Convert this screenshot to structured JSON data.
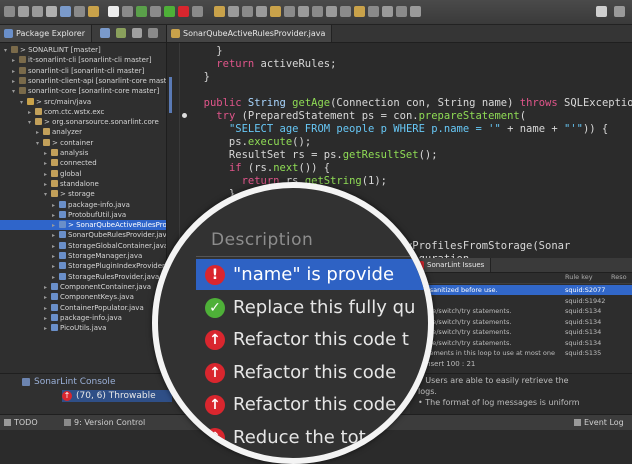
{
  "colors": {
    "accent": "#2f65ca",
    "error": "#d9262e",
    "ok": "#4eb038",
    "keyword": "#e0558a",
    "string": "#67c7f5"
  },
  "explorer": {
    "tabs": [
      {
        "label": "Package Explorer",
        "icon": "package-icon"
      }
    ],
    "items": [
      {
        "label": "> SONARLINT [master]",
        "depth": 0,
        "kind": "project",
        "expanded": true
      },
      {
        "label": "it-sonarlint-cli [sonarlint-cli master]",
        "depth": 1,
        "kind": "project"
      },
      {
        "label": "sonarlint-cli [sonarlint-cli master]",
        "depth": 1,
        "kind": "project"
      },
      {
        "label": "sonarlint-client-api [sonarlint-core master]",
        "depth": 1,
        "kind": "project"
      },
      {
        "label": "sonarlint-core [sonarlint-core master]",
        "depth": 1,
        "kind": "project",
        "expanded": true
      },
      {
        "label": "> src/main/java",
        "depth": 2,
        "kind": "folder",
        "expanded": true
      },
      {
        "label": "com.ctc.wstx.exc",
        "depth": 3,
        "kind": "package"
      },
      {
        "label": "> org.sonarsource.sonarlint.core",
        "depth": 3,
        "kind": "package",
        "expanded": true
      },
      {
        "label": "analyzer",
        "depth": 4,
        "kind": "package"
      },
      {
        "label": "> container",
        "depth": 4,
        "kind": "package",
        "expanded": true
      },
      {
        "label": "analysis",
        "depth": 5,
        "kind": "package"
      },
      {
        "label": "connected",
        "depth": 5,
        "kind": "package"
      },
      {
        "label": "global",
        "depth": 5,
        "kind": "package"
      },
      {
        "label": "standalone",
        "depth": 5,
        "kind": "package"
      },
      {
        "label": "> storage",
        "depth": 5,
        "kind": "package",
        "expanded": true
      },
      {
        "label": "package-info.java",
        "depth": 6,
        "kind": "java"
      },
      {
        "label": "ProtobufUtil.java",
        "depth": 6,
        "kind": "java"
      },
      {
        "label": "> SonarQubeActiveRulesProvider.java",
        "depth": 6,
        "kind": "java",
        "selected": true
      },
      {
        "label": "SonarQubeRulesProvider.java",
        "depth": 6,
        "kind": "java"
      },
      {
        "label": "StorageGlobalContainer.java",
        "depth": 6,
        "kind": "java"
      },
      {
        "label": "StorageManager.java",
        "depth": 6,
        "kind": "java"
      },
      {
        "label": "StoragePluginIndexProvider.java",
        "depth": 6,
        "kind": "java"
      },
      {
        "label": "StorageRulesProvider.java",
        "depth": 6,
        "kind": "java"
      },
      {
        "label": "ComponentContainer.java",
        "depth": 5,
        "kind": "java"
      },
      {
        "label": "ComponentKeys.java",
        "depth": 5,
        "kind": "java"
      },
      {
        "label": "ContainerPopulator.java",
        "depth": 5,
        "kind": "java"
      },
      {
        "label": "package-info.java",
        "depth": 5,
        "kind": "java"
      },
      {
        "label": "PicoUtils.java",
        "depth": 5,
        "kind": "java"
      }
    ]
  },
  "editor": {
    "tab": "SonarQubeActiveRulesProvider.java",
    "lines": [
      [
        {
          "t": "    }",
          "c": "plain"
        }
      ],
      [
        {
          "t": "    ",
          "c": "plain"
        },
        {
          "t": "return",
          "c": "kw"
        },
        {
          "t": " activeRules;",
          "c": "plain"
        }
      ],
      [
        {
          "t": "  }",
          "c": "plain"
        }
      ],
      [
        {
          "t": "",
          "c": "plain"
        }
      ],
      [
        {
          "t": "  ",
          "c": "plain"
        },
        {
          "t": "public",
          "c": "kw"
        },
        {
          "t": " String ",
          "c": "ty"
        },
        {
          "t": "getAge",
          "c": "fn"
        },
        {
          "t": "(Connection con, String name) ",
          "c": "plain"
        },
        {
          "t": "throws",
          "c": "kw"
        },
        {
          "t": " SQLException {",
          "c": "plain"
        }
      ],
      [
        {
          "t": "    ",
          "c": "plain"
        },
        {
          "t": "try",
          "c": "kw"
        },
        {
          "t": " (PreparedStatement ps = con.",
          "c": "plain"
        },
        {
          "t": "prepareStatement",
          "c": "fn"
        },
        {
          "t": "(",
          "c": "plain"
        }
      ],
      [
        {
          "t": "      ",
          "c": "plain"
        },
        {
          "t": "\"SELECT age FROM people p WHERE p.name = '\"",
          "c": "str"
        },
        {
          "t": " + name + ",
          "c": "plain"
        },
        {
          "t": "\"'\"",
          "c": "str"
        },
        {
          "t": ")) {",
          "c": "plain"
        }
      ],
      [
        {
          "t": "      ps.",
          "c": "plain"
        },
        {
          "t": "execute",
          "c": "fn"
        },
        {
          "t": "();",
          "c": "plain"
        }
      ],
      [
        {
          "t": "      ResultSet rs = ps.",
          "c": "plain"
        },
        {
          "t": "getResultSet",
          "c": "fn"
        },
        {
          "t": "();",
          "c": "plain"
        }
      ],
      [
        {
          "t": "      ",
          "c": "plain"
        },
        {
          "t": "if",
          "c": "kw"
        },
        {
          "t": " (rs.",
          "c": "plain"
        },
        {
          "t": "next",
          "c": "fn"
        },
        {
          "t": "()) {",
          "c": "plain"
        }
      ],
      [
        {
          "t": "        ",
          "c": "plain"
        },
        {
          "t": "return",
          "c": "kw"
        },
        {
          "t": " rs.",
          "c": "plain"
        },
        {
          "t": "getString",
          "c": "fn"
        },
        {
          "t": "(1);",
          "c": "plain"
        }
      ],
      [
        {
          "t": "      }",
          "c": "plain"
        }
      ],
      [
        {
          "t": "      ",
          "c": "plain"
        },
        {
          "t": "re",
          "c": "kw"
        }
      ],
      [
        {
          "t": "",
          "c": "plain"
        }
      ],
      [
        {
          "t": "",
          "c": "plain"
        }
      ],
      [
        {
          "t": "                      > loadQualityProfilesFromStorage(Sonar",
          "c": "plain"
        }
      ],
      [
        {
          "t": "                      .analysisConfiguration",
          "c": "plain"
        }
      ]
    ]
  },
  "issues_view": {
    "tab": "SonarLint Issues",
    "columns": {
      "rule_key": "Rule key",
      "resource": "Reso"
    },
    "rows": [
      {
        "text": "not sanitized before use.",
        "rule": "squid:S2077",
        "selected": true
      },
      {
        "text": "",
        "rule": "squid:S1942"
      },
      {
        "text": "/while/switch/try statements.",
        "rule": "squid:S134"
      },
      {
        "text": "/while/switch/try statements.",
        "rule": "squid:S134"
      },
      {
        "text": "/while/switch/try statements.",
        "rule": "squid:S134"
      },
      {
        "text": "/while/switch/try statements.",
        "rule": "squid:S134"
      },
      {
        "text": "statements in this loop to use at most one",
        "rule": "squid:S135"
      }
    ]
  },
  "console": {
    "position": "Insert   100 : 21",
    "lines": [
      "• Users are able to easily retrieve the",
      "  logs.",
      "• The format of log messages is uniform"
    ]
  },
  "left_console": {
    "title": "SonarLint Console",
    "entry": "(70, 6) Throwable"
  },
  "statusbar": {
    "todo": "TODO",
    "version_control": "9: Version Control",
    "event_log": "Event Log"
  },
  "magnifier": {
    "heading": "Description",
    "rows": [
      {
        "text": "\"name\" is provide",
        "icon": "error-icon",
        "selected": true
      },
      {
        "text": "Replace this fully qu",
        "icon": "check-icon"
      },
      {
        "text": "Refactor this code t",
        "icon": "arrow-up-icon"
      },
      {
        "text": "Refactor this code",
        "icon": "arrow-up-icon"
      },
      {
        "text": "Refactor this code",
        "icon": "arrow-up-icon"
      },
      {
        "text": "Reduce the tot",
        "icon": "arrow-up-icon"
      }
    ]
  }
}
